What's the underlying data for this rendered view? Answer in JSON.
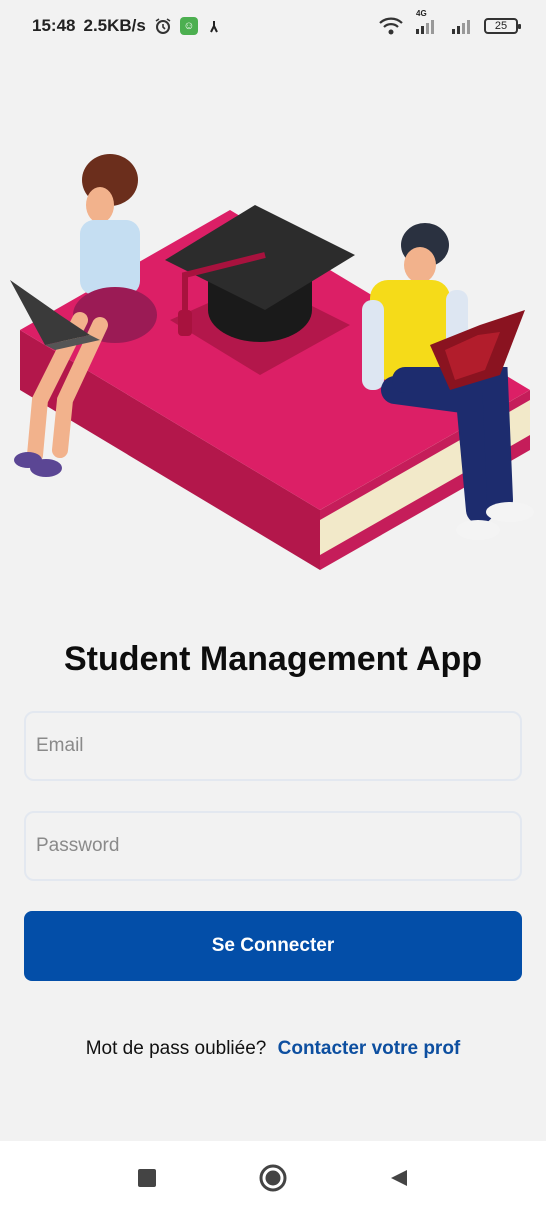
{
  "status_bar": {
    "time": "15:48",
    "speed": "2.5KB/s",
    "network_label": "4G",
    "battery_level": "25"
  },
  "main": {
    "title": "Student Management App",
    "email_placeholder": "Email",
    "password_placeholder": "Password",
    "login_label": "Se Connecter",
    "forgot_text": "Mot de pass oubliée?",
    "contact_link": "Contacter votre prof"
  },
  "colors": {
    "primary": "#034ea8",
    "link": "#0d4fa0",
    "background": "#f2f2f2"
  },
  "icons": [
    "alarm-icon",
    "app-icon",
    "wifi-icon",
    "signal-icon",
    "battery-icon",
    "recent-apps-icon",
    "home-icon",
    "back-icon"
  ]
}
